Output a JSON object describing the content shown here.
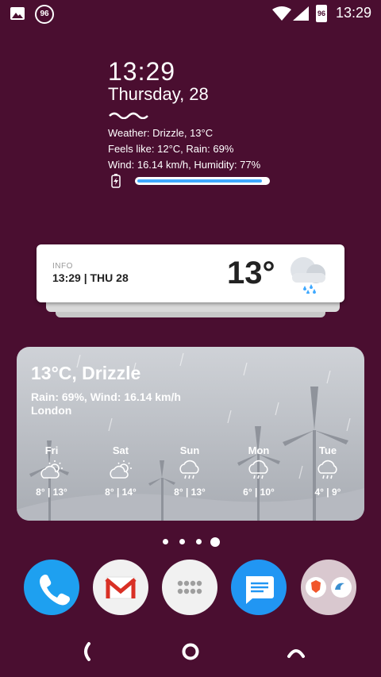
{
  "status_bar": {
    "left_icons": [
      "image-icon",
      "notification-96-icon"
    ],
    "notification_badge": "96",
    "battery_label": "96",
    "time": "13:29"
  },
  "clock_widget": {
    "time": "13:29",
    "date": "Thursday, 28",
    "weather_line": "Weather: Drizzle, 13°C",
    "feels_line": "Feels like: 12°C, Rain: 69%",
    "wind_line": "Wind: 16.14 km/h, Humidity: 77%",
    "battery_level": 0.96
  },
  "info_card": {
    "label": "INFO",
    "datetime": "13:29 | THU 28",
    "temperature": "13°",
    "icon": "drizzle-cloud-icon"
  },
  "weather_card": {
    "title": "13°C, Drizzle",
    "details": "Rain: 69%, Wind: 16.14 km/h",
    "location": "London",
    "forecast": [
      {
        "day": "Fri",
        "range": "8° | 13°",
        "icon": "partly-cloudy-icon"
      },
      {
        "day": "Sat",
        "range": "8° | 14°",
        "icon": "partly-cloudy-icon"
      },
      {
        "day": "Sun",
        "range": "8° | 13°",
        "icon": "rain-cloud-icon"
      },
      {
        "day": "Mon",
        "range": "6° | 10°",
        "icon": "rain-cloud-icon"
      },
      {
        "day": "Tue",
        "range": "4° | 9°",
        "icon": "rain-cloud-icon"
      }
    ]
  },
  "page_indicator": {
    "count": 4,
    "active": 4
  },
  "dock": [
    "phone-icon",
    "gmail-icon",
    "app-drawer-icon",
    "messages-icon",
    "folder-icon"
  ],
  "colors": {
    "wallpaper": "#4a0e30",
    "phone": "#1ea0f0",
    "messages": "#2196f3",
    "gmail": "#d93025"
  }
}
